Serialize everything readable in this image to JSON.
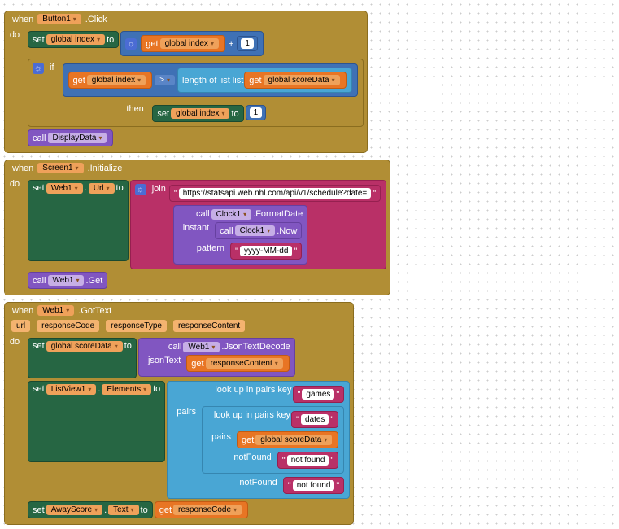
{
  "b1": {
    "when": "when",
    "click": ".Click",
    "btn": "Button1",
    "do": "do",
    "set": "set",
    "gidx": "global index",
    "to": "to",
    "get": "get",
    "plus": "+",
    "one": "1",
    "if": "if",
    "gt": ">",
    "lol": "length of list  list",
    "gsd": "global scoreData",
    "then": "then",
    "call": "call",
    "dd": "DisplayData"
  },
  "b2": {
    "when": "when",
    "scr": "Screen1",
    "init": ".Initialize",
    "do": "do",
    "set": "set",
    "web": "Web1",
    "dot": ".",
    "url": "Url",
    "to": "to",
    "join": "join",
    "api": "https://statsapi.web.nhl.com/api/v1/schedule?date=",
    "call": "call",
    "clk": "Clock1",
    "fmt": ".FormatDate",
    "inst": "instant",
    "now": ".Now",
    "pat": "pattern",
    "ymd": "yyyy-MM-dd",
    "get": ".Get"
  },
  "b3": {
    "when": "when",
    "web": "Web1",
    "got": ".GotText",
    "url": "url",
    "rc": "responseCode",
    "rt": "responseType",
    "rcon": "responseContent",
    "do": "do",
    "set": "set",
    "gsd": "global scoreData",
    "to": "to",
    "call": "call",
    "jtd": ".JsonTextDecode",
    "jtx": "jsonText",
    "get": "get",
    "lv": "ListView1",
    "dot": ".",
    "el": "Elements",
    "lup": "look up in pairs  key",
    "games": "games",
    "pairs": "pairs",
    "dates": "dates",
    "nf": "notFound",
    "nft": "not found",
    "aws": "AwayScore",
    "txt": "Text"
  }
}
